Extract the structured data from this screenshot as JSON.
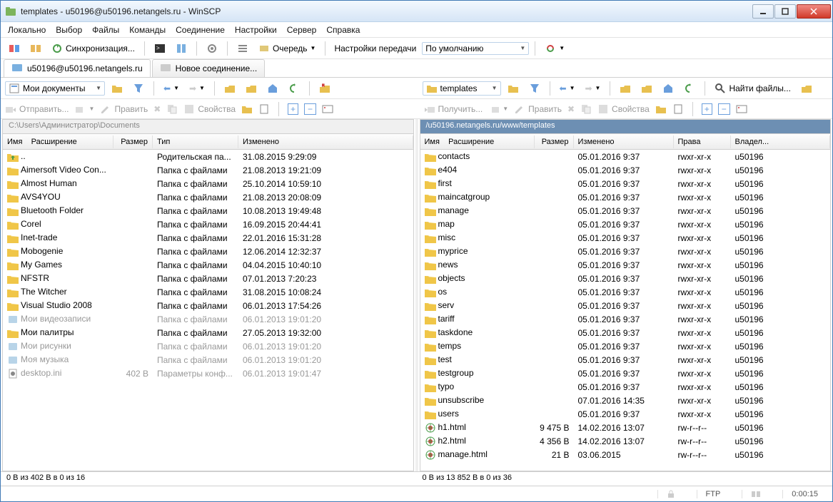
{
  "window": {
    "title": "templates - u50196@u50196.netangels.ru - WinSCP"
  },
  "menu": [
    "Локально",
    "Выбор",
    "Файлы",
    "Команды",
    "Соединение",
    "Настройки",
    "Сервер",
    "Справка"
  ],
  "toolbar": {
    "sync": "Синхронизация...",
    "queue": "Очередь",
    "transfer": "Настройки передачи",
    "preset": "По умолчанию"
  },
  "tabs": {
    "session": "u50196@u50196.netangels.ru",
    "new": "Новое соединение..."
  },
  "local": {
    "combo": "Мои документы",
    "actions": {
      "send": "Отправить...",
      "edit": "Править",
      "props": "Свойства"
    },
    "path": "C:\\Users\\Администратор\\Documents",
    "headers": {
      "name": "Имя",
      "ext": "Расширение",
      "size": "Размер",
      "type": "Тип",
      "changed": "Изменено"
    },
    "rows": [
      {
        "i": "up",
        "n": "..",
        "s": "",
        "t": "Родительская па...",
        "c": "31.08.2015 9:29:09"
      },
      {
        "i": "f",
        "n": "Aimersoft Video Con...",
        "s": "",
        "t": "Папка с файлами",
        "c": "21.08.2013 19:21:09"
      },
      {
        "i": "f",
        "n": "Almost Human",
        "s": "",
        "t": "Папка с файлами",
        "c": "25.10.2014 10:59:10"
      },
      {
        "i": "f",
        "n": "AVS4YOU",
        "s": "",
        "t": "Папка с файлами",
        "c": "21.08.2013 20:08:09"
      },
      {
        "i": "f",
        "n": "Bluetooth Folder",
        "s": "",
        "t": "Папка с файлами",
        "c": "10.08.2013 19:49:48"
      },
      {
        "i": "f",
        "n": "Corel",
        "s": "",
        "t": "Папка с файлами",
        "c": "16.09.2015 20:44:41"
      },
      {
        "i": "f",
        "n": "Inet-trade",
        "s": "",
        "t": "Папка с файлами",
        "c": "22.01.2016 15:31:28"
      },
      {
        "i": "f",
        "n": "Mobogenie",
        "s": "",
        "t": "Папка с файлами",
        "c": "12.06.2014 12:32:37"
      },
      {
        "i": "f",
        "n": "My Games",
        "s": "",
        "t": "Папка с файлами",
        "c": "04.04.2015 10:40:10"
      },
      {
        "i": "f",
        "n": "NFSTR",
        "s": "",
        "t": "Папка с файлами",
        "c": "07.01.2013 7:20:23"
      },
      {
        "i": "f",
        "n": "The Witcher",
        "s": "",
        "t": "Папка с файлами",
        "c": "31.08.2015 10:08:24"
      },
      {
        "i": "f",
        "n": "Visual Studio 2008",
        "s": "",
        "t": "Папка с файлами",
        "c": "06.01.2013 17:54:26"
      },
      {
        "i": "lib",
        "n": "Мои видеозаписи",
        "s": "",
        "t": "Папка с файлами",
        "c": "06.01.2013 19:01:20",
        "dim": true
      },
      {
        "i": "f",
        "n": "Мои палитры",
        "s": "",
        "t": "Папка с файлами",
        "c": "27.05.2013 19:32:00"
      },
      {
        "i": "lib",
        "n": "Мои рисунки",
        "s": "",
        "t": "Папка с файлами",
        "c": "06.01.2013 19:01:20",
        "dim": true
      },
      {
        "i": "lib",
        "n": "Моя музыка",
        "s": "",
        "t": "Папка с файлами",
        "c": "06.01.2013 19:01:20",
        "dim": true
      },
      {
        "i": "ini",
        "n": "desktop.ini",
        "s": "402 B",
        "t": "Параметры конф...",
        "c": "06.01.2013 19:01:47",
        "dim": true
      }
    ],
    "status": "0 B из 402 B в 0 из 16"
  },
  "remote": {
    "combo": "templates",
    "find": "Найти файлы...",
    "actions": {
      "get": "Получить...",
      "edit": "Править",
      "props": "Свойства"
    },
    "path": "/u50196.netangels.ru/www/templates",
    "headers": {
      "name": "Имя",
      "ext": "Расширение",
      "size": "Размер",
      "changed": "Изменено",
      "rights": "Права",
      "owner": "Владел..."
    },
    "rows": [
      {
        "i": "f",
        "n": "contacts",
        "s": "",
        "c": "05.01.2016 9:37",
        "r": "rwxr-xr-x",
        "o": "u50196"
      },
      {
        "i": "f",
        "n": "e404",
        "s": "",
        "c": "05.01.2016 9:37",
        "r": "rwxr-xr-x",
        "o": "u50196"
      },
      {
        "i": "f",
        "n": "first",
        "s": "",
        "c": "05.01.2016 9:37",
        "r": "rwxr-xr-x",
        "o": "u50196"
      },
      {
        "i": "f",
        "n": "maincatgroup",
        "s": "",
        "c": "05.01.2016 9:37",
        "r": "rwxr-xr-x",
        "o": "u50196"
      },
      {
        "i": "f",
        "n": "manage",
        "s": "",
        "c": "05.01.2016 9:37",
        "r": "rwxr-xr-x",
        "o": "u50196"
      },
      {
        "i": "f",
        "n": "map",
        "s": "",
        "c": "05.01.2016 9:37",
        "r": "rwxr-xr-x",
        "o": "u50196"
      },
      {
        "i": "f",
        "n": "misc",
        "s": "",
        "c": "05.01.2016 9:37",
        "r": "rwxr-xr-x",
        "o": "u50196"
      },
      {
        "i": "f",
        "n": "myprice",
        "s": "",
        "c": "05.01.2016 9:37",
        "r": "rwxr-xr-x",
        "o": "u50196"
      },
      {
        "i": "f",
        "n": "news",
        "s": "",
        "c": "05.01.2016 9:37",
        "r": "rwxr-xr-x",
        "o": "u50196"
      },
      {
        "i": "f",
        "n": "objects",
        "s": "",
        "c": "05.01.2016 9:37",
        "r": "rwxr-xr-x",
        "o": "u50196"
      },
      {
        "i": "f",
        "n": "os",
        "s": "",
        "c": "05.01.2016 9:37",
        "r": "rwxr-xr-x",
        "o": "u50196"
      },
      {
        "i": "f",
        "n": "serv",
        "s": "",
        "c": "05.01.2016 9:37",
        "r": "rwxr-xr-x",
        "o": "u50196"
      },
      {
        "i": "f",
        "n": "tariff",
        "s": "",
        "c": "05.01.2016 9:37",
        "r": "rwxr-xr-x",
        "o": "u50196"
      },
      {
        "i": "f",
        "n": "taskdone",
        "s": "",
        "c": "05.01.2016 9:37",
        "r": "rwxr-xr-x",
        "o": "u50196"
      },
      {
        "i": "f",
        "n": "temps",
        "s": "",
        "c": "05.01.2016 9:37",
        "r": "rwxr-xr-x",
        "o": "u50196"
      },
      {
        "i": "f",
        "n": "test",
        "s": "",
        "c": "05.01.2016 9:37",
        "r": "rwxr-xr-x",
        "o": "u50196"
      },
      {
        "i": "f",
        "n": "testgroup",
        "s": "",
        "c": "05.01.2016 9:37",
        "r": "rwxr-xr-x",
        "o": "u50196"
      },
      {
        "i": "f",
        "n": "typo",
        "s": "",
        "c": "05.01.2016 9:37",
        "r": "rwxr-xr-x",
        "o": "u50196"
      },
      {
        "i": "f",
        "n": "unsubscribe",
        "s": "",
        "c": "07.01.2016 14:35",
        "r": "rwxr-xr-x",
        "o": "u50196"
      },
      {
        "i": "f",
        "n": "users",
        "s": "",
        "c": "05.01.2016 9:37",
        "r": "rwxr-xr-x",
        "o": "u50196"
      },
      {
        "i": "html",
        "n": "h1.html",
        "s": "9 475 B",
        "c": "14.02.2016 13:07",
        "r": "rw-r--r--",
        "o": "u50196"
      },
      {
        "i": "html",
        "n": "h2.html",
        "s": "4 356 B",
        "c": "14.02.2016 13:07",
        "r": "rw-r--r--",
        "o": "u50196"
      },
      {
        "i": "html",
        "n": "manage.html",
        "s": "21 B",
        "c": "03.06.2015",
        "r": "rw-r--r--",
        "o": "u50196"
      }
    ],
    "status": "0 B из 13 852 B в 0 из 36"
  },
  "footer": {
    "proto": "FTP",
    "time": "0:00:15"
  }
}
